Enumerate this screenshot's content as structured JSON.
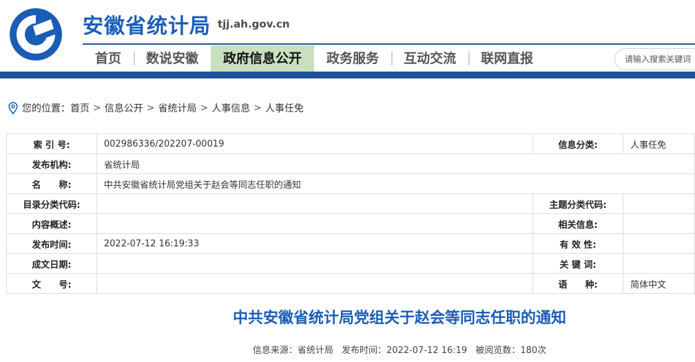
{
  "header": {
    "site_title": "安徽省统计局",
    "site_domain": "tjj.ah.gov.cn",
    "nav": [
      {
        "label": "首页"
      },
      {
        "label": "数说安徽"
      },
      {
        "label": "政府信息公开"
      },
      {
        "label": "政务服务"
      },
      {
        "label": "互动交流"
      },
      {
        "label": "联网直报"
      }
    ],
    "active_nav": "政府信息公开",
    "search_placeholder": "请输入搜索关键词"
  },
  "breadcrumb": {
    "prefix": "您的位置：",
    "items": [
      "首页",
      "信息公开",
      "省统计局",
      "人事信息",
      "人事任免"
    ],
    "separator": ">"
  },
  "info": {
    "rows": [
      {
        "label": "索 引 号:",
        "value": "002986336/202207-00019",
        "label2": "信息分类:",
        "value2": "人事任免"
      },
      {
        "label": "发布机构:",
        "value": "省统计局"
      },
      {
        "label": "名　　称:",
        "value": "中共安徽省统计局党组关于赵会等同志任职的通知"
      },
      {
        "label": "目录分类代码:",
        "value": "",
        "label2": "主题分类代码:",
        "value2": ""
      },
      {
        "label": "内容概述:",
        "value": "",
        "label2": "相关信息:",
        "value2": ""
      },
      {
        "label": "发布时间:",
        "value": "2022-07-12 16:19:33",
        "label2": "有 效 性:",
        "value2": ""
      },
      {
        "label": "成文日期:",
        "value": "",
        "label2": "关 键 词:",
        "value2": ""
      },
      {
        "label": "文　　号:",
        "value": "",
        "label2": "语　　种:",
        "value2": "简体中文"
      }
    ]
  },
  "article": {
    "title": "中共安徽省统计局党组关于赵会等同志任职的通知",
    "meta": {
      "source": "信息来源：省统计局",
      "published": "发布时间：2022-07-12 16:19",
      "views": "被阅览数：180次"
    }
  },
  "colors": {
    "brand_blue": "#1a5db5",
    "band_blue": "#1f4f99",
    "active_nav_bg": "#c9dfbe"
  }
}
